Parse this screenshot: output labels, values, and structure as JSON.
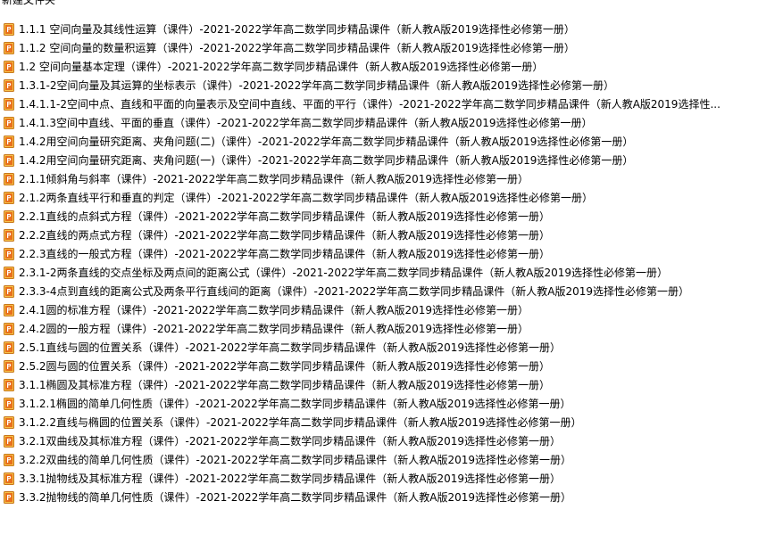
{
  "header": {
    "title": "新建文件夹"
  },
  "icon": {
    "name": "powerpoint-file-icon",
    "color": "#e0741c",
    "accent": "#f5c24a"
  },
  "files": [
    "1.1.1 空间向量及其线性运算（课件）-2021-2022学年高二数学同步精品课件（新人教A版2019选择性必修第一册）",
    "1.1.2 空间向量的数量积运算（课件）-2021-2022学年高二数学同步精品课件（新人教A版2019选择性必修第一册）",
    "1.2 空间向量基本定理（课件）-2021-2022学年高二数学同步精品课件（新人教A版2019选择性必修第一册）",
    "1.3.1-2空间向量及其运算的坐标表示（课件）-2021-2022学年高二数学同步精品课件（新人教A版2019选择性必修第一册）",
    "1.4.1.1-2空间中点、直线和平面的向量表示及空间中直线、平面的平行（课件）-2021-2022学年高二数学同步精品课件（新人教A版2019选择性...",
    "1.4.1.3空间中直线、平面的垂直（课件）-2021-2022学年高二数学同步精品课件（新人教A版2019选择性必修第一册）",
    "1.4.2用空间向量研究距离、夹角问题(二)（课件）-2021-2022学年高二数学同步精品课件（新人教A版2019选择性必修第一册）",
    "1.4.2用空间向量研究距离、夹角问题(一)（课件）-2021-2022学年高二数学同步精品课件（新人教A版2019选择性必修第一册）",
    "2.1.1倾斜角与斜率（课件）-2021-2022学年高二数学同步精品课件（新人教A版2019选择性必修第一册）",
    "2.1.2两条直线平行和垂直的判定（课件）-2021-2022学年高二数学同步精品课件（新人教A版2019选择性必修第一册）",
    "2.2.1直线的点斜式方程（课件）-2021-2022学年高二数学同步精品课件（新人教A版2019选择性必修第一册）",
    "2.2.2直线的两点式方程（课件）-2021-2022学年高二数学同步精品课件（新人教A版2019选择性必修第一册）",
    "2.2.3直线的一般式方程（课件）-2021-2022学年高二数学同步精品课件（新人教A版2019选择性必修第一册）",
    "2.3.1-2两条直线的交点坐标及两点间的距离公式（课件）-2021-2022学年高二数学同步精品课件（新人教A版2019选择性必修第一册）",
    "2.3.3-4点到直线的距离公式及两条平行直线间的距离（课件）-2021-2022学年高二数学同步精品课件（新人教A版2019选择性必修第一册）",
    "2.4.1圆的标准方程（课件）-2021-2022学年高二数学同步精品课件（新人教A版2019选择性必修第一册）",
    "2.4.2圆的一般方程（课件）-2021-2022学年高二数学同步精品课件（新人教A版2019选择性必修第一册）",
    "2.5.1直线与圆的位置关系（课件）-2021-2022学年高二数学同步精品课件（新人教A版2019选择性必修第一册）",
    "2.5.2圆与圆的位置关系（课件）-2021-2022学年高二数学同步精品课件（新人教A版2019选择性必修第一册）",
    "3.1.1椭圆及其标准方程（课件）-2021-2022学年高二数学同步精品课件（新人教A版2019选择性必修第一册）",
    "3.1.2.1椭圆的简单几何性质（课件）-2021-2022学年高二数学同步精品课件（新人教A版2019选择性必修第一册）",
    "3.1.2.2直线与椭圆的位置关系（课件）-2021-2022学年高二数学同步精品课件（新人教A版2019选择性必修第一册）",
    "3.2.1双曲线及其标准方程（课件）-2021-2022学年高二数学同步精品课件（新人教A版2019选择性必修第一册）",
    "3.2.2双曲线的简单几何性质（课件）-2021-2022学年高二数学同步精品课件（新人教A版2019选择性必修第一册）",
    "3.3.1抛物线及其标准方程（课件）-2021-2022学年高二数学同步精品课件（新人教A版2019选择性必修第一册）",
    "3.3.2抛物线的简单几何性质（课件）-2021-2022学年高二数学同步精品课件（新人教A版2019选择性必修第一册）"
  ]
}
